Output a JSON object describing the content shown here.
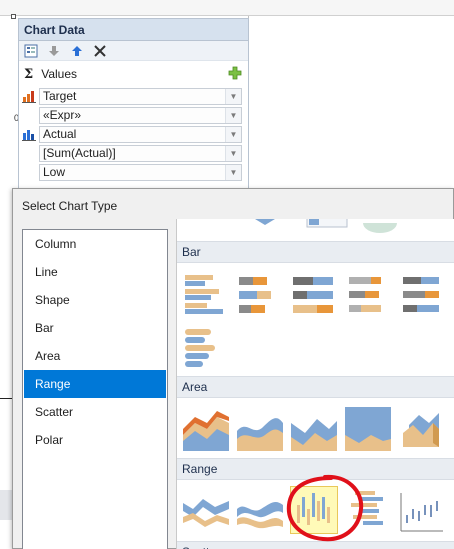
{
  "chart_data_panel": {
    "title": "Chart Data",
    "toolbar": {
      "icons": [
        "properties-icon",
        "move-down-icon",
        "move-up-icon",
        "delete-icon"
      ]
    },
    "values_label": "Values",
    "add_icon": "add-icon",
    "rows": [
      {
        "value": "Target",
        "icon": "bar-chart-icon"
      },
      {
        "value": "«Expr»"
      },
      {
        "value": "Actual",
        "icon": "column-chart-icon"
      },
      {
        "value": "[Sum(Actual)]"
      },
      {
        "value": "Low"
      }
    ]
  },
  "dialog": {
    "title": "Select Chart Type",
    "chart_types": [
      "Column",
      "Line",
      "Shape",
      "Bar",
      "Area",
      "Range",
      "Scatter",
      "Polar"
    ],
    "selected_type": "Range",
    "sections": [
      {
        "label": "Bar"
      },
      {
        "label": "Area"
      },
      {
        "label": "Range"
      },
      {
        "label": "Scatter"
      }
    ]
  },
  "colors": {
    "accent_blue": "#0078d7",
    "chart_blue": "#7fa6d3",
    "chart_orange": "#e8c08a",
    "highlight_yellow": "#fffab8",
    "annotation_red": "#e0101a"
  }
}
